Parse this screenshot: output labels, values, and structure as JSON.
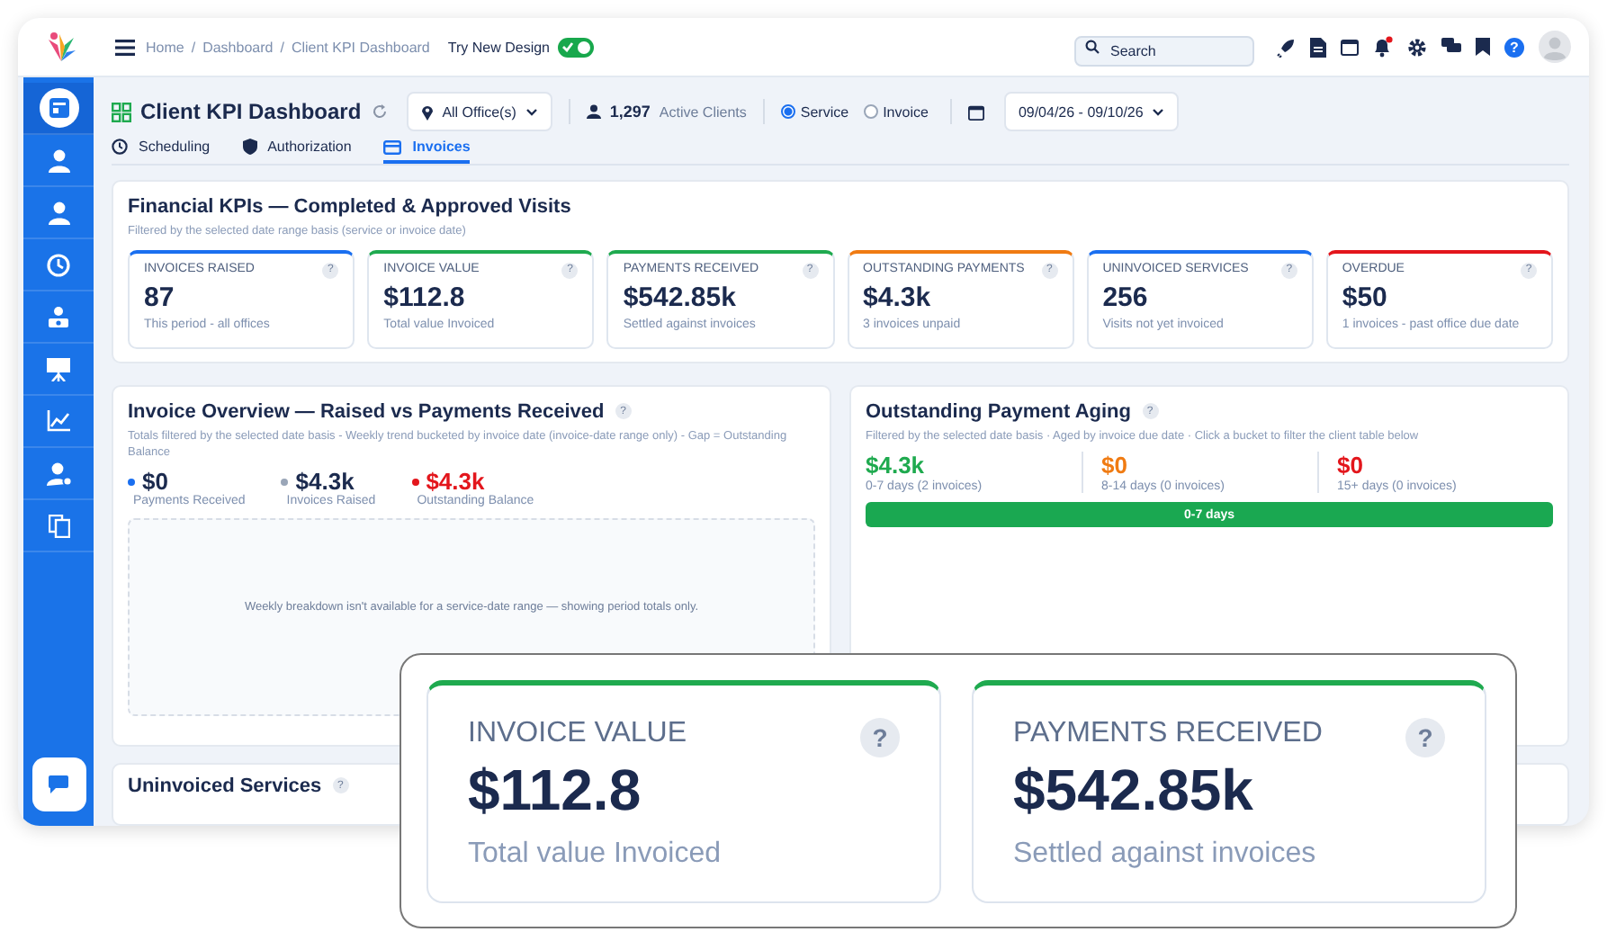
{
  "topbar": {
    "breadcrumbs": [
      "Home",
      "/",
      "Dashboard",
      "/",
      "Client KPI Dashboard"
    ],
    "new_design": {
      "label": "Try New Design",
      "on": true
    },
    "search": {
      "placeholder": "Search"
    },
    "help": "?"
  },
  "sidebar": {
    "items": [
      {
        "selected": true
      },
      {
        "selected": false
      },
      {
        "selected": false
      },
      {
        "selected": false
      },
      {
        "selected": false
      },
      {
        "selected": false
      },
      {
        "selected": false
      },
      {
        "selected": false
      },
      {
        "selected": false
      }
    ]
  },
  "header": {
    "title": "Client KPI Dashboard",
    "office_filter": "All Office(s)",
    "active_clients": {
      "count": "1,297",
      "label": "Active Clients"
    },
    "date_basis": [
      {
        "label": "Service",
        "selected": true
      },
      {
        "label": "Invoice",
        "selected": false
      }
    ],
    "date_range": "09/04/26 - 09/10/26"
  },
  "tabs": [
    {
      "label": "Scheduling",
      "selected": false
    },
    {
      "label": "Authorization",
      "selected": false
    },
    {
      "label": "Invoices",
      "selected": true
    }
  ],
  "financial_kpis": {
    "title": "Financial KPIs — Completed & Approved Visits",
    "subtitle": "Filtered by the selected date range basis (service or invoice date)",
    "cards": [
      {
        "label": "INVOICES RAISED",
        "value": "87",
        "note": "This period - all offices",
        "color": "#1a6ff0",
        "help": "?"
      },
      {
        "label": "INVOICE VALUE",
        "value": "$112.8",
        "note": "Total value Invoiced",
        "color": "#1faa4f",
        "help": "?"
      },
      {
        "label": "PAYMENTS RECEIVED",
        "value": "$542.85k",
        "note": "Settled against invoices",
        "color": "#1faa4f",
        "help": "?"
      },
      {
        "label": "OUTSTANDING PAYMENTS",
        "value": "$4.3k",
        "note": "3 invoices unpaid",
        "color": "#f07b12",
        "help": "?"
      },
      {
        "label": "UNINVOICED SERVICES",
        "value": "256",
        "note": "Visits not yet invoiced",
        "color": "#1a6ff0",
        "help": "?"
      },
      {
        "label": "OVERDUE",
        "value": "$50",
        "note": "1 invoices - past office due date",
        "color": "#e3161c",
        "help": "?"
      }
    ]
  },
  "invoice_overview": {
    "title": "Invoice Overview — Raised vs Payments Received",
    "help": "?",
    "subtitle": "Totals filtered by the selected date basis - Weekly trend bucketed by invoice date (invoice-date range only) - Gap = Outstanding Balance",
    "totals": [
      {
        "value": "$0",
        "label": "Payments Received",
        "color": "#1a6ff0",
        "alert": false
      },
      {
        "value": "$4.3k",
        "label": "Invoices Raised",
        "color": "#9aa6b8",
        "alert": false
      },
      {
        "value": "$4.3k",
        "label": "Outstanding Balance",
        "color": "#e3161c",
        "alert": true
      }
    ],
    "chart_message": "Weekly breakdown isn't available for a service-date range — showing period totals only."
  },
  "payment_aging": {
    "title": "Outstanding Payment Aging",
    "help": "?",
    "subtitle": "Filtered by the selected date basis · Aged by invoice due date · Click a bucket to filter the client table below",
    "buckets": [
      {
        "value": "$4.3k",
        "label": "0-7 days (2 invoices)",
        "color": "#1faa4f"
      },
      {
        "value": "$0",
        "label": "8-14 days (0 invoices)",
        "color": "#f07b12"
      },
      {
        "value": "$0",
        "label": "15+ days (0 invoices)",
        "color": "#e3161c"
      }
    ],
    "bar": {
      "label": "0-7 days",
      "level": 1
    }
  },
  "uninvoiced_services": {
    "title": "Uninvoiced Services",
    "help": "?"
  },
  "zoom_inset": {
    "cards": [
      {
        "label": "INVOICE VALUE",
        "value": "$112.8",
        "note": "Total value Invoiced",
        "color": "#1faa4f",
        "help": "?"
      },
      {
        "label": "PAYMENTS RECEIVED",
        "value": "$542.85k",
        "note": "Settled against invoices",
        "color": "#1faa4f",
        "help": "?"
      }
    ]
  }
}
